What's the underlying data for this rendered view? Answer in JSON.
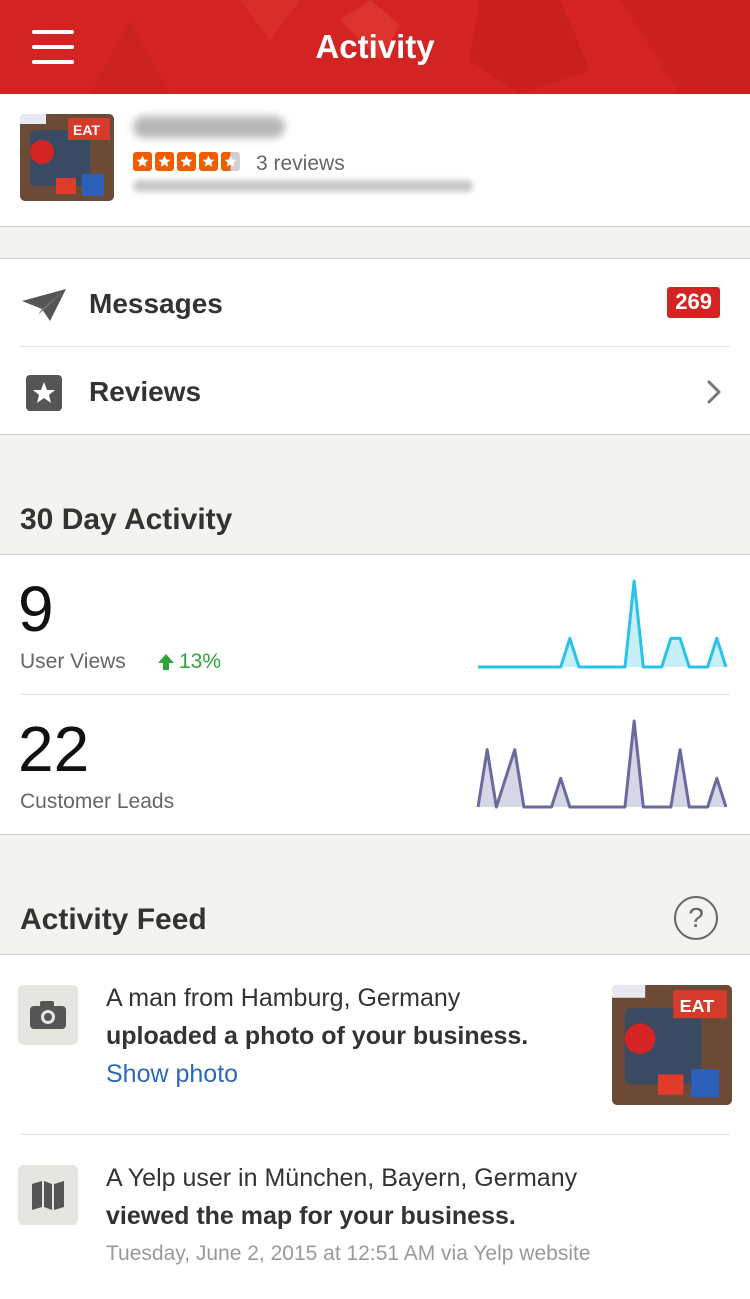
{
  "navbar": {
    "title": "Activity"
  },
  "business": {
    "rating_stars": 4.5,
    "review_count": "3 reviews",
    "thumb_text": "EAT"
  },
  "menu": {
    "messages_label": "Messages",
    "messages_badge": "269",
    "reviews_label": "Reviews"
  },
  "activity": {
    "section_title": "30 Day Activity",
    "user_views": {
      "value": "9",
      "label": "User Views",
      "change": "13%"
    },
    "customer_leads": {
      "value": "22",
      "label": "Customer Leads"
    }
  },
  "chart_data": [
    {
      "type": "area",
      "series": [
        {
          "values": [
            0,
            0,
            0,
            0,
            0,
            0,
            0,
            0,
            0,
            0,
            1,
            0,
            0,
            0,
            0,
            0,
            0,
            3,
            0,
            0,
            0,
            1,
            1,
            0,
            0,
            0,
            1,
            0
          ]
        }
      ],
      "color": "#29c3ea"
    },
    {
      "type": "area",
      "series": [
        {
          "values": [
            0,
            2,
            0,
            1,
            2,
            0,
            0,
            0,
            0,
            1,
            0,
            0,
            0,
            0,
            0,
            0,
            0,
            3,
            0,
            0,
            0,
            0,
            2,
            0,
            0,
            0,
            1,
            0
          ]
        }
      ],
      "color": "#6a6a9e"
    }
  ],
  "feed": {
    "section_title": "Activity Feed",
    "help_label": "?",
    "items": [
      {
        "line1": "A man from Hamburg, Germany",
        "line2": "uploaded a photo of your business.",
        "link": "Show photo",
        "icon": "camera-icon"
      },
      {
        "line1": "A Yelp user in München, Bayern, Germany",
        "line2": "viewed the map for your business.",
        "meta": "Tuesday, June 2, 2015 at 12:51 AM via Yelp website",
        "icon": "map-icon"
      }
    ]
  }
}
